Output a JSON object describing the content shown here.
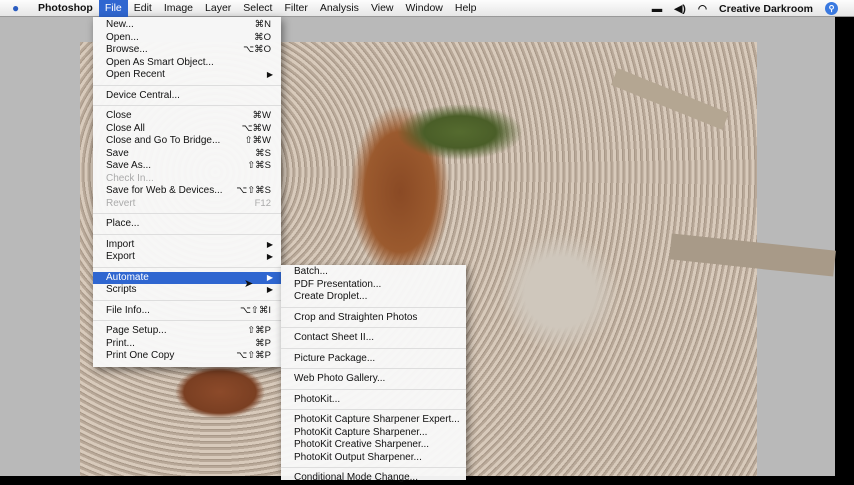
{
  "menubar": {
    "app": "Photoshop",
    "items": [
      "File",
      "Edit",
      "Image",
      "Layer",
      "Select",
      "Filter",
      "Analysis",
      "View",
      "Window",
      "Help"
    ],
    "user": "Creative Darkroom"
  },
  "file_menu": [
    {
      "label": "New...",
      "shortcut": "⌘N"
    },
    {
      "label": "Open...",
      "shortcut": "⌘O"
    },
    {
      "label": "Browse...",
      "shortcut": "⌥⌘O"
    },
    {
      "label": "Open As Smart Object..."
    },
    {
      "label": "Open Recent",
      "submenu": true
    },
    {
      "sep": true
    },
    {
      "label": "Device Central..."
    },
    {
      "sep": true
    },
    {
      "label": "Close",
      "shortcut": "⌘W"
    },
    {
      "label": "Close All",
      "shortcut": "⌥⌘W"
    },
    {
      "label": "Close and Go To Bridge...",
      "shortcut": "⇧⌘W"
    },
    {
      "label": "Save",
      "shortcut": "⌘S"
    },
    {
      "label": "Save As...",
      "shortcut": "⇧⌘S"
    },
    {
      "label": "Check In...",
      "disabled": true
    },
    {
      "label": "Save for Web & Devices...",
      "shortcut": "⌥⇧⌘S"
    },
    {
      "label": "Revert",
      "shortcut": "F12",
      "disabled": true
    },
    {
      "sep": true
    },
    {
      "label": "Place..."
    },
    {
      "sep": true
    },
    {
      "label": "Import",
      "submenu": true
    },
    {
      "label": "Export",
      "submenu": true
    },
    {
      "sep": true
    },
    {
      "label": "Automate",
      "submenu": true,
      "highlighted": true
    },
    {
      "label": "Scripts",
      "submenu": true
    },
    {
      "sep": true
    },
    {
      "label": "File Info...",
      "shortcut": "⌥⇧⌘I"
    },
    {
      "sep": true
    },
    {
      "label": "Page Setup...",
      "shortcut": "⇧⌘P"
    },
    {
      "label": "Print...",
      "shortcut": "⌘P"
    },
    {
      "label": "Print One Copy",
      "shortcut": "⌥⇧⌘P"
    }
  ],
  "automate_menu": [
    {
      "label": "Batch..."
    },
    {
      "label": "PDF Presentation..."
    },
    {
      "label": "Create Droplet..."
    },
    {
      "sep": true
    },
    {
      "label": "Crop and Straighten Photos"
    },
    {
      "sep": true
    },
    {
      "label": "Contact Sheet II..."
    },
    {
      "sep": true
    },
    {
      "label": "Picture Package..."
    },
    {
      "sep": true
    },
    {
      "label": "Web Photo Gallery..."
    },
    {
      "sep": true
    },
    {
      "label": "PhotoKit..."
    },
    {
      "sep": true
    },
    {
      "label": "PhotoKit Capture Sharpener Expert..."
    },
    {
      "label": "PhotoKit Capture Sharpener..."
    },
    {
      "label": "PhotoKit Creative Sharpener..."
    },
    {
      "label": "PhotoKit Output Sharpener..."
    },
    {
      "sep": true
    },
    {
      "label": "Conditional Mode Change..."
    }
  ]
}
